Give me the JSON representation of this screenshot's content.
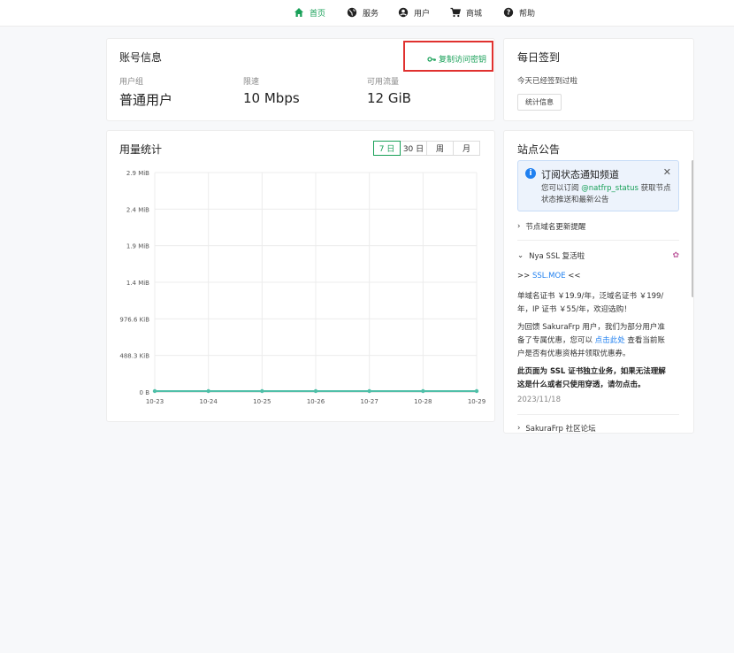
{
  "nav": {
    "items": [
      {
        "label": "首页",
        "icon": "home-icon",
        "active": true
      },
      {
        "label": "服务",
        "icon": "globe-icon",
        "active": false
      },
      {
        "label": "用户",
        "icon": "user-icon",
        "active": false
      },
      {
        "label": "商城",
        "icon": "cart-icon",
        "active": false
      },
      {
        "label": "帮助",
        "icon": "help-icon",
        "active": false
      }
    ]
  },
  "account": {
    "title": "账号信息",
    "copy_key_label": "复制访问密钥",
    "group_label": "用户组",
    "group_value": "普通用户",
    "speed_label": "限速",
    "speed_value": "10 Mbps",
    "traffic_label": "可用流量",
    "traffic_value": "12 GiB"
  },
  "signin": {
    "title": "每日签到",
    "status": "今天已经签到过啦",
    "stats_button": "统计信息"
  },
  "usage": {
    "title": "用量统计",
    "tabs": [
      {
        "label": "7 日",
        "active": true
      },
      {
        "label": "30 日",
        "active": false
      },
      {
        "label": "周",
        "active": false
      },
      {
        "label": "月",
        "active": false
      }
    ]
  },
  "chart_data": {
    "type": "area",
    "x": [
      "10-23",
      "10-24",
      "10-25",
      "10-26",
      "10-27",
      "10-28",
      "10-29"
    ],
    "yticks": [
      "0 B",
      "488.3 KiB",
      "976.6 KiB",
      "1.4 MiB",
      "1.9 MiB",
      "2.4 MiB",
      "2.9 MiB"
    ],
    "ylim_bytes": [
      0,
      3000000
    ],
    "series": [
      {
        "values": [
          0,
          0,
          0,
          0,
          0,
          0,
          0
        ]
      }
    ],
    "grid": true,
    "line_color": "#4fbfa8"
  },
  "announcements": {
    "title": "站点公告",
    "notice": {
      "title": "订阅状态通知频道",
      "body_prefix": "您可以订阅 ",
      "body_link": "@natfrp_status",
      "body_suffix": " 获取节点状态推送和最新公告",
      "close_icon": "close-icon"
    },
    "items": [
      {
        "title": "节点域名更新提醒",
        "expanded": false
      },
      {
        "title": "Nya SSL 复活啦",
        "expanded": true
      },
      {
        "title": "SakuraFrp 社区论坛",
        "expanded": false
      }
    ],
    "ssl": {
      "link_prefix": ">> ",
      "link": "SSL.MOE",
      "link_suffix": " <<",
      "para1": "单域名证书 ￥19.9/年，泛域名证书 ￥199/年，IP 证书 ￥55/年，欢迎选购！",
      "para2_prefix": "为回馈 SakuraFrp 用户，我们为部分用户准备了专属优惠，您可以 ",
      "para2_link": "点击此处",
      "para2_suffix": " 查看当前账户是否有优惠资格并领取优惠券。",
      "para3": "此页面为 SSL 证书独立业务，如果无法理解这是什么或者只使用穿透，请勿点击。",
      "date": "2023/11/18"
    }
  }
}
